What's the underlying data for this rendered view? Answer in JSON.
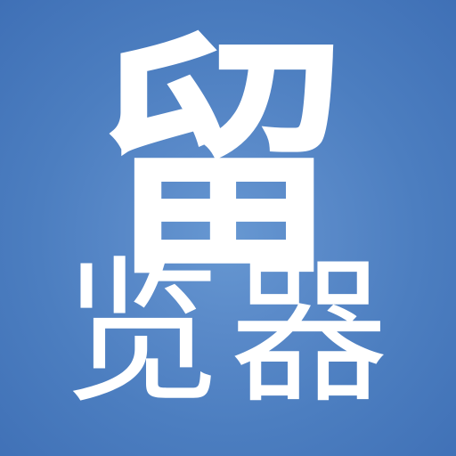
{
  "icon": {
    "main_character": "留",
    "subtitle_characters": "览器",
    "background_color": "#4f82c3",
    "text_color": "#ffffff"
  }
}
